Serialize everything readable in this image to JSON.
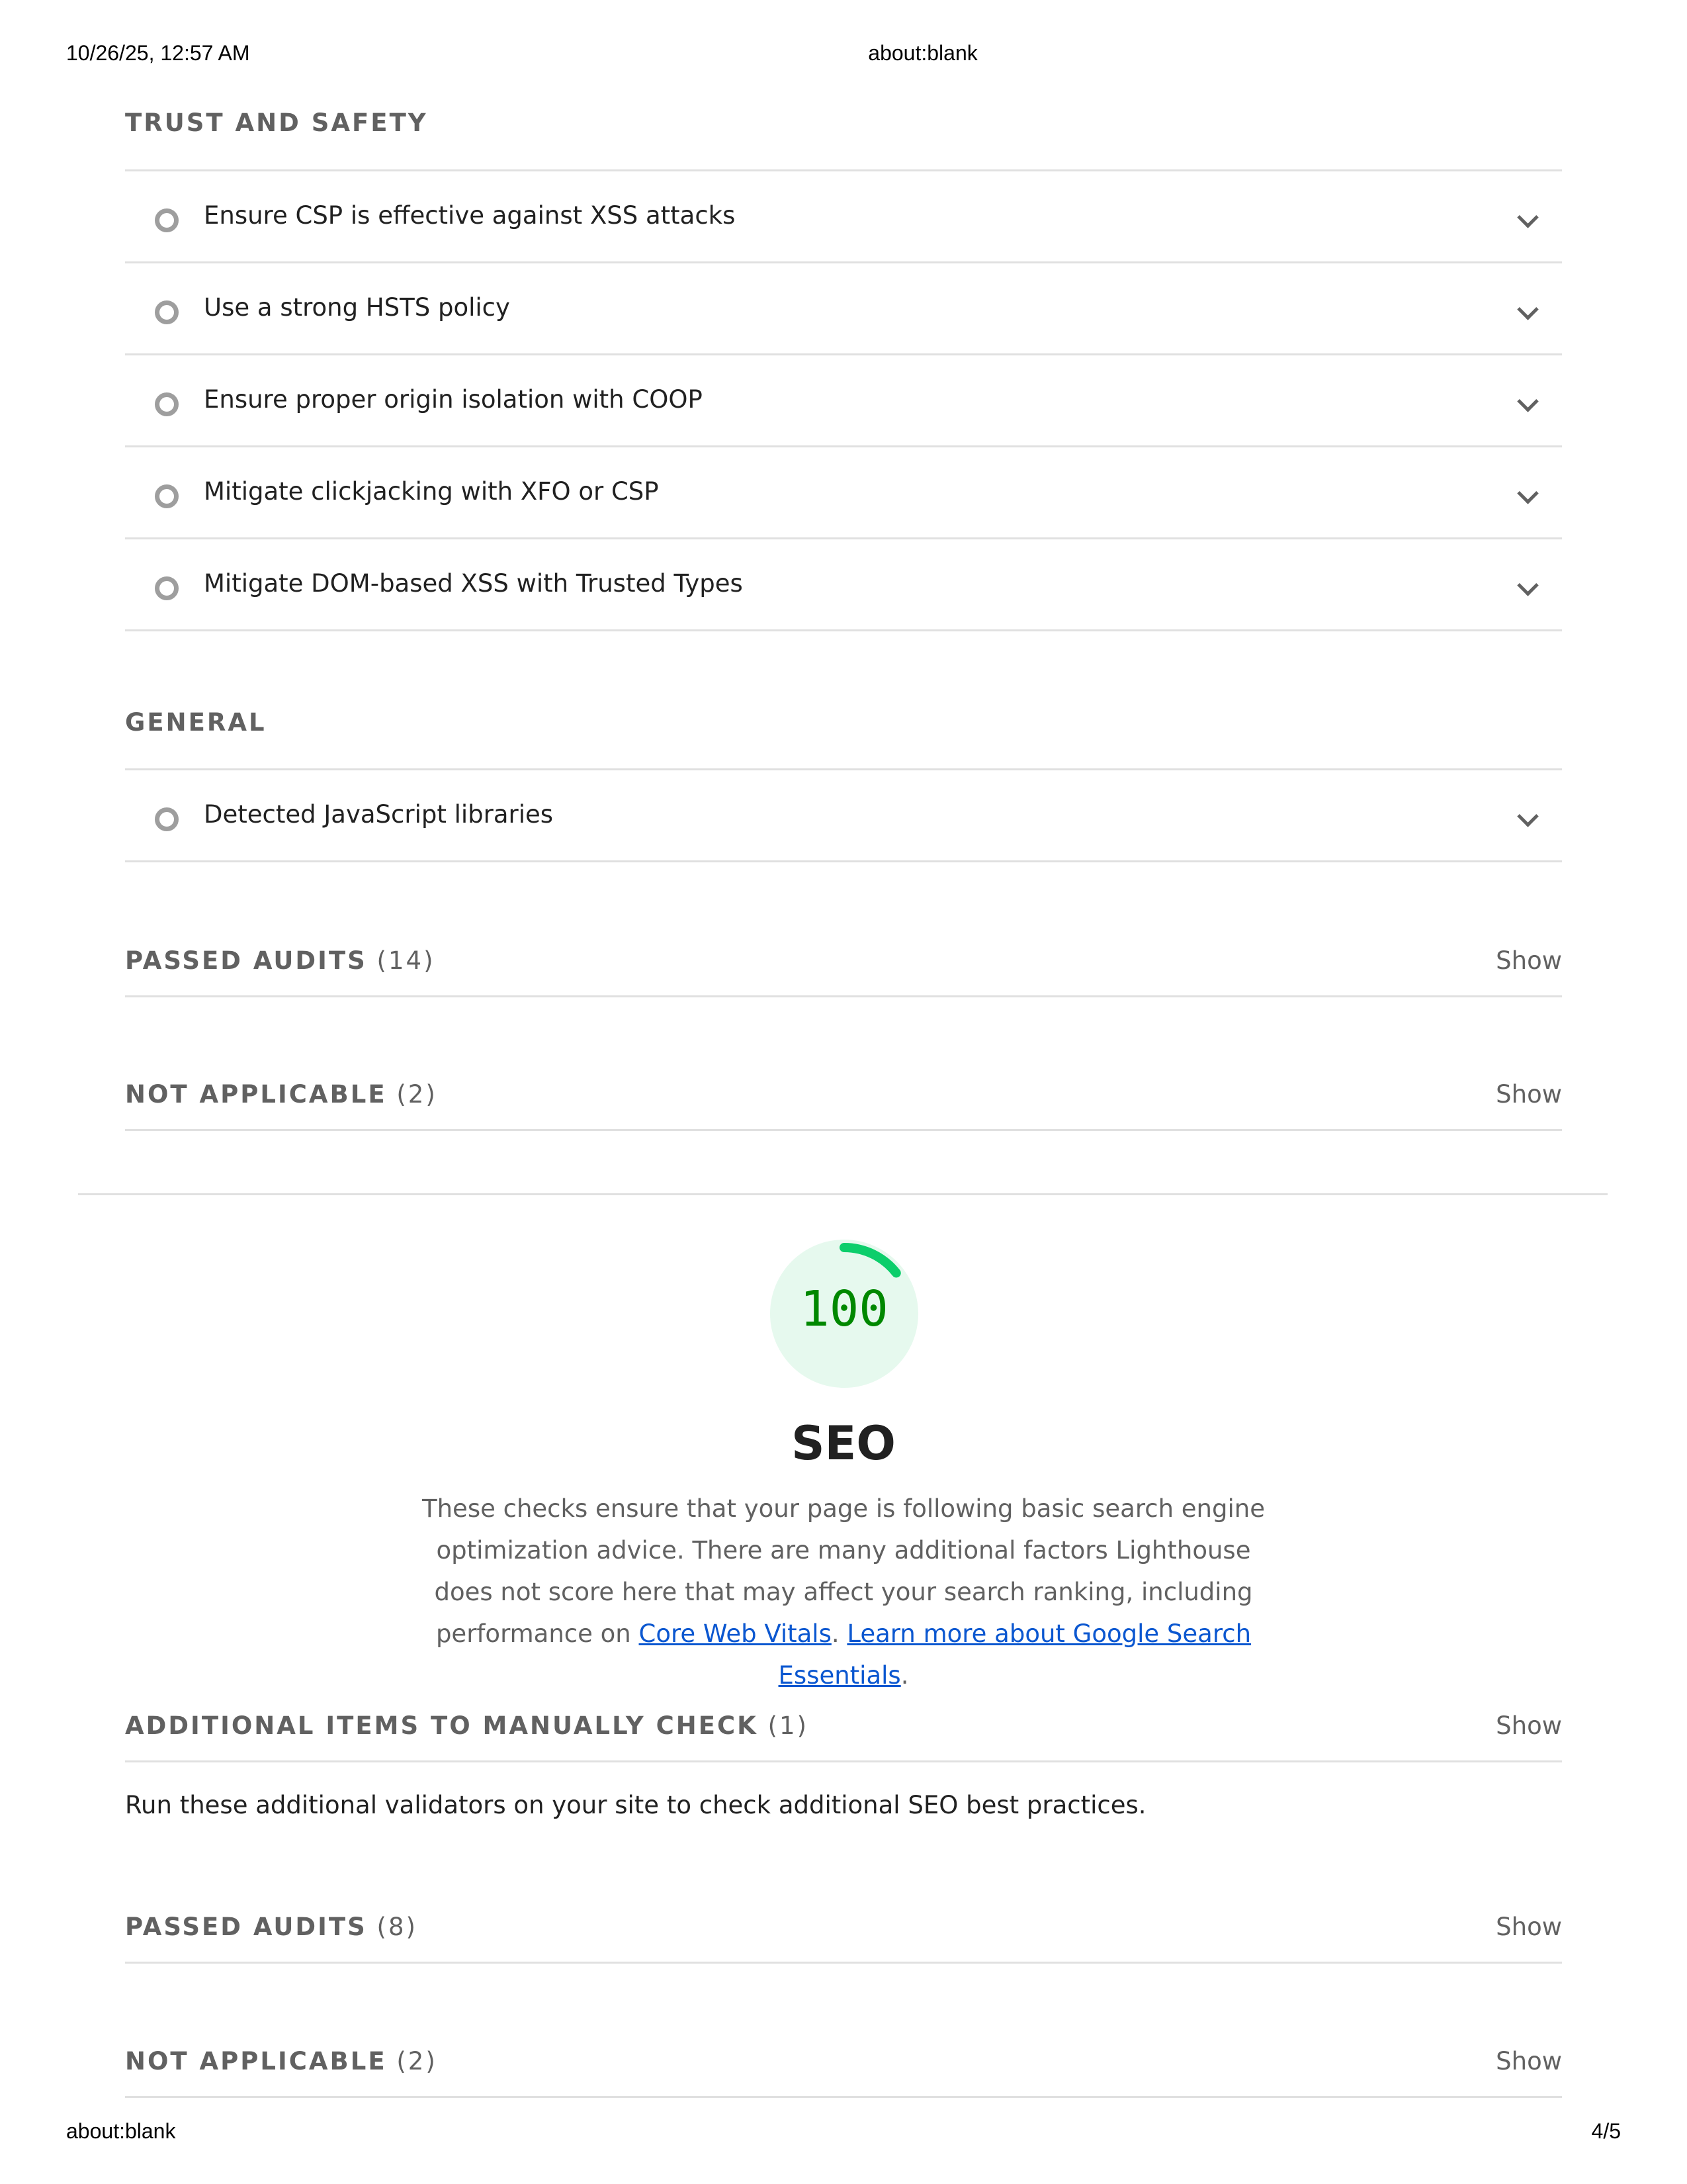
{
  "print_header": {
    "datetime": "10/26/25, 12:57 AM",
    "url": "about:blank"
  },
  "print_footer": {
    "url": "about:blank",
    "page": "4/5"
  },
  "trust_safety": {
    "title": "TRUST AND SAFETY",
    "items": [
      {
        "label": "Ensure CSP is effective against XSS attacks"
      },
      {
        "label": "Use a strong HSTS policy"
      },
      {
        "label": "Ensure proper origin isolation with COOP"
      },
      {
        "label": "Mitigate clickjacking with XFO or CSP"
      },
      {
        "label": "Mitigate DOM-based XSS with Trusted Types"
      }
    ]
  },
  "general": {
    "title": "GENERAL",
    "items": [
      {
        "label": "Detected JavaScript libraries"
      }
    ]
  },
  "bp_passed": {
    "label": "PASSED AUDITS",
    "count": "(14)",
    "action": "Show"
  },
  "bp_not_applicable": {
    "label": "NOT APPLICABLE",
    "count": "(2)",
    "action": "Show"
  },
  "seo": {
    "score": "100",
    "score_fraction": 1.0,
    "title": "SEO",
    "description": "These checks ensure that your page is following basic search engine optimization advice. There are many additional factors Lighthouse does not score here that may affect your search ranking, including performance on",
    "link1": "Core Web Vitals",
    "sep": ".",
    "link2": "Learn more about Google Search Essentials",
    "end": ".",
    "manual": {
      "label": "ADDITIONAL ITEMS TO MANUALLY CHECK",
      "count": "(1)",
      "action": "Show"
    },
    "manual_text": "Run these additional validators on your site to check additional SEO best practices.",
    "passed": {
      "label": "PASSED AUDITS",
      "count": "(8)",
      "action": "Show"
    },
    "not_applicable": {
      "label": "NOT APPLICABLE",
      "count": "(2)",
      "action": "Show"
    }
  },
  "colors": {
    "pass": "#0cce6b",
    "pass_bg": "#e6f9ee",
    "pass_text": "#008800",
    "link": "#0b57d0"
  }
}
